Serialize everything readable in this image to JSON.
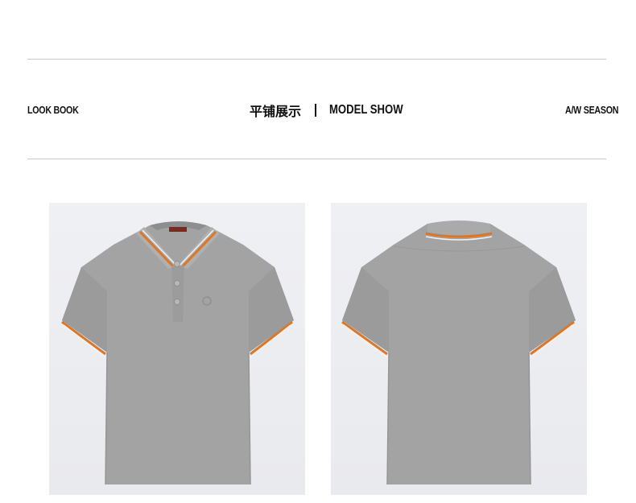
{
  "header": {
    "left_label": "LOOK BOOK",
    "title_cn": "平铺展示",
    "title_en": "MODEL SHOW",
    "right_label": "A/W SEASON"
  },
  "colors": {
    "shirt": "#a3a3a3",
    "shirt_shadow": "#8f8f8f",
    "tipping_orange": "#d9782b",
    "tipping_white": "#f2f2f2",
    "photo_bg": "#eceef1",
    "rule": "#c8c8c8"
  },
  "photos": [
    {
      "name": "polo-front-flat",
      "view": "front"
    },
    {
      "name": "polo-back-flat",
      "view": "back"
    }
  ]
}
